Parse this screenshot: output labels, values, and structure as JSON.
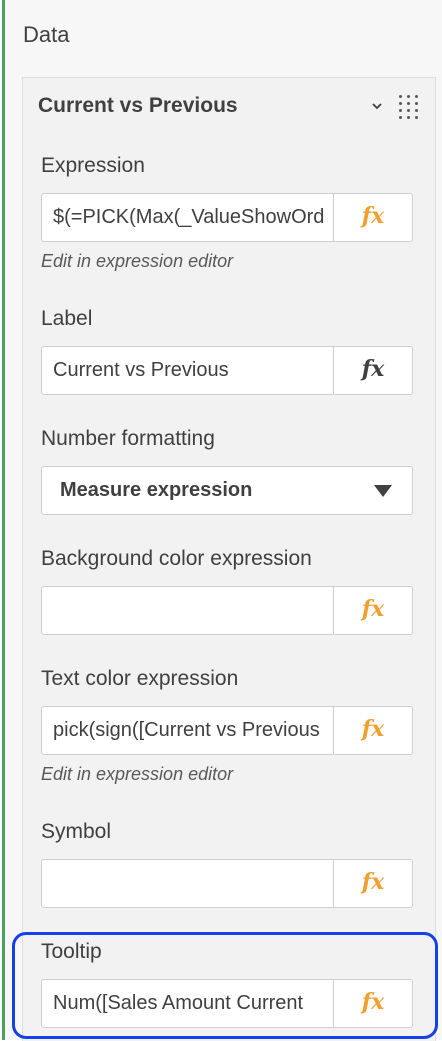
{
  "section": {
    "title": "Data"
  },
  "card": {
    "title": "Current vs Previous"
  },
  "fields": {
    "expression": {
      "label": "Expression",
      "value": "$(=PICK(Max(_ValueShowOrder),",
      "link": "Edit in expression editor"
    },
    "label_field": {
      "label": "Label",
      "value": "Current vs Previous"
    },
    "number_formatting": {
      "label": "Number formatting",
      "selected": "Measure expression"
    },
    "background_color": {
      "label": "Background color expression",
      "value": ""
    },
    "text_color": {
      "label": "Text color expression",
      "value": "pick(sign([Current vs Previous",
      "link": "Edit in expression editor"
    },
    "symbol": {
      "label": "Symbol",
      "value": ""
    },
    "tooltip": {
      "label": "Tooltip",
      "value": "Num([Sales Amount Current"
    }
  },
  "fx_glyph": "fx",
  "icons": {
    "collapse": "chevron-down-icon",
    "drag": "drag-handle-icon",
    "dropdown": "caret-down-icon"
  },
  "colors": {
    "accent_green": "#4ca15f",
    "fx_orange": "#f0a030",
    "highlight_blue": "#1640e8"
  }
}
